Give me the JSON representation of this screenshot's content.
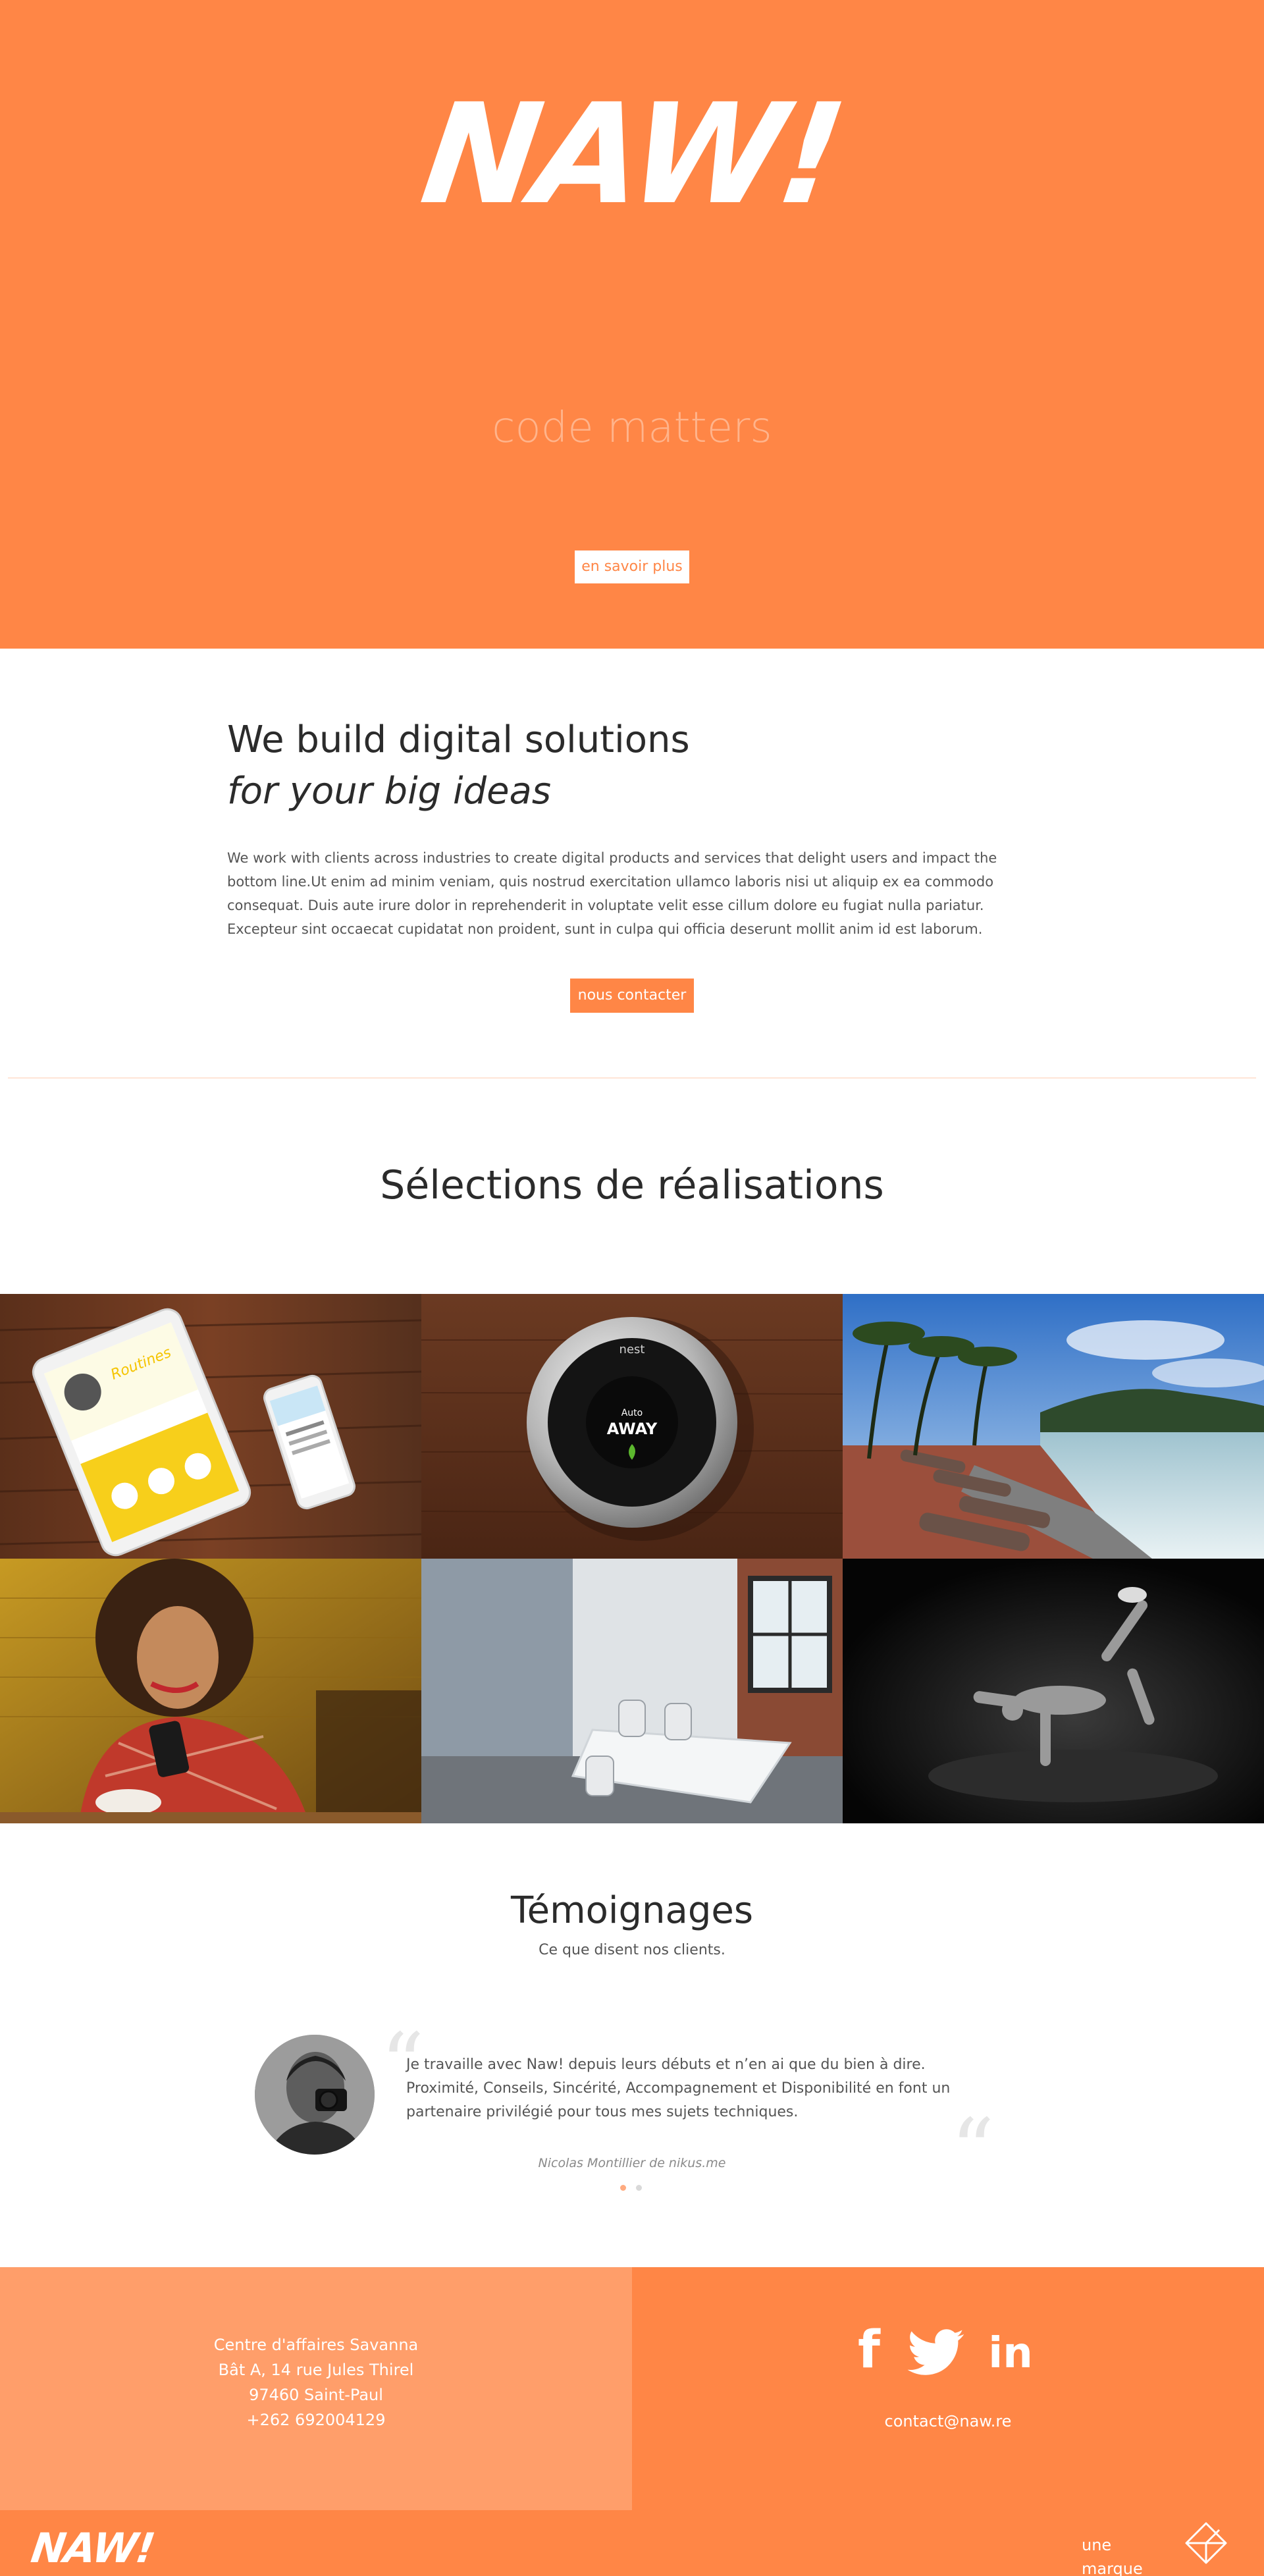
{
  "hero": {
    "logo": "NAW!",
    "tagline": "code matters",
    "cta_label": "en savoir plus"
  },
  "intro": {
    "title": "We build digital solutions",
    "subtitle": "for your big ideas",
    "paragraph": "We work with clients across industries to create digital products and services that delight users and impact the bottom line.Ut enim ad minim veniam, quis nostrud exercitation ullamco laboris nisi ut aliquip ex ea commodo consequat. Duis aute irure dolor in reprehenderit in voluptate velit esse cillum dolore eu fugiat nulla pariatur. Excepteur sint occaecat cupidatat non proident, sunt in culpa qui officia deserunt mollit anim id est laborum.",
    "cta_label": "nous contacter"
  },
  "works": {
    "title": "Sélections de réalisations",
    "items": [
      {
        "name": "tablet-phone-mockup-project"
      },
      {
        "name": "nest-thermostat-project",
        "device_brand": "nest",
        "device_mode": "Auto",
        "device_status": "AWAY"
      },
      {
        "name": "seaside-cannons-project"
      },
      {
        "name": "woman-with-phone-project"
      },
      {
        "name": "meeting-room-project"
      },
      {
        "name": "breakdancer-project"
      }
    ]
  },
  "testimonials": {
    "title": "Témoignages",
    "subtitle": "Ce que disent nos clients.",
    "quote": "Je travaille avec Naw! depuis leurs débuts et n’en ai que du bien à dire. Proximité, Conseils, Sincérité, Accompagnement et Disponibilité en font un partenaire privilégié pour tous mes sujets techniques.",
    "author": "Nicolas Montillier de nikus.me",
    "quote_open": "“",
    "quote_close": "“",
    "slide_count": 2,
    "active_slide": 1
  },
  "footer": {
    "address_line1": "Centre d'affaires Savanna",
    "address_line2": "Bât A, 14 rue Jules Thirel",
    "address_line3": "97460 Saint-Paul",
    "phone": "+262 692004129",
    "social": [
      "facebook-icon",
      "twitter-icon",
      "linkedin-icon"
    ],
    "social_labels": {
      "facebook": "f",
      "linkedin": "in"
    },
    "email": "contact@naw.re",
    "logo": "NAW!",
    "brand_text": "une marque"
  },
  "colors": {
    "brand_orange": "#ff8646",
    "light_orange": "#ff9e6a",
    "tagline_tint": "#ffb48c",
    "white": "#ffffff",
    "text_dark": "#2b2b2b"
  }
}
